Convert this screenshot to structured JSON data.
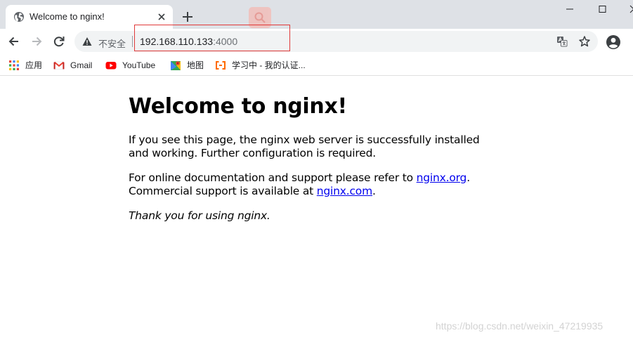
{
  "browser": {
    "tab": {
      "title": "Welcome to nginx!"
    },
    "address_bar": {
      "security_label": "不安全",
      "url_host": "192.168.110.133",
      "url_port": ":4000"
    },
    "bookmarks": [
      {
        "label": "应用",
        "icon": "apps-grid-icon"
      },
      {
        "label": "Gmail",
        "icon": "gmail-icon"
      },
      {
        "label": "YouTube",
        "icon": "youtube-icon"
      },
      {
        "label": "地图",
        "icon": "maps-icon"
      },
      {
        "label": "学习中 - 我的认证...",
        "icon": "bookmark-site-icon"
      }
    ],
    "colors": {
      "tabstrip": "#dee1e6",
      "omnibox": "#f1f3f4",
      "highlight_box": "#e03a3a"
    }
  },
  "page": {
    "heading": "Welcome to nginx!",
    "paragraph1": "If you see this page, the nginx web server is successfully installed and working. Further configuration is required.",
    "paragraph2_prefix": "For online documentation and support please refer to ",
    "link_org": "nginx.org",
    "paragraph2_mid": ".",
    "paragraph2_line2_prefix": "Commercial support is available at ",
    "link_com": "nginx.com",
    "paragraph2_suffix": ".",
    "thanks": "Thank you for using nginx.",
    "link_color": "#0000ee"
  },
  "watermark": "https://blog.csdn.net/weixin_47219935"
}
